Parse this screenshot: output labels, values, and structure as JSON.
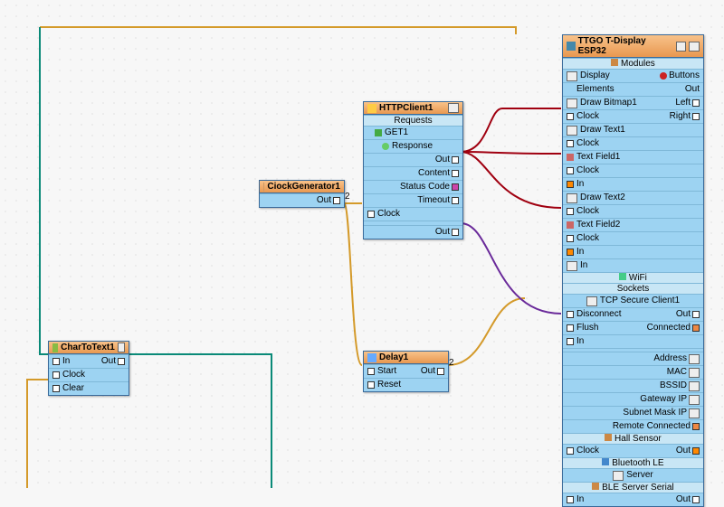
{
  "nodes": {
    "char": {
      "title": "CharToText1",
      "rows": [
        "In",
        "Clock",
        "Clear"
      ],
      "out": "Out"
    },
    "clockgen": {
      "title": "CiockGenerator1",
      "out": "Out"
    },
    "http": {
      "title": "HTTPClient1",
      "sec1": "Requests",
      "rows": [
        "GET1",
        "Response"
      ],
      "outs": [
        "Out",
        "Content",
        "Status Code",
        "Timeout"
      ],
      "clock": "Clock",
      "bottom": "Out"
    },
    "delay": {
      "title": "Delay1",
      "rows": [
        "Start",
        "Reset"
      ],
      "out": "Out"
    },
    "esp": {
      "title": "TTGO T-Display ESP32",
      "modules": "Modules",
      "display": "Display",
      "buttons": "Buttons",
      "elements": "Elements",
      "out": "Out",
      "drawbm": "Draw Bitmap1",
      "left": "Left",
      "right": "Right",
      "clock": "Clock",
      "drawt1": "Draw Text1",
      "tf1": "Text Field1",
      "in": "In",
      "drawt2": "Draw Text2",
      "tf2": "Text Field2",
      "wifi": "WiFi",
      "sockets": "Sockets",
      "tcp": "TCP Secure Client1",
      "disconnect": "Disconnect",
      "connected": "Connected",
      "flush": "Flush",
      "address": "Address",
      "mac": "MAC",
      "bssid": "BSSID",
      "gateway": "Gateway IP",
      "subnet": "Subnet Mask IP",
      "remote": "Remote Connected",
      "hall": "Hall Sensor",
      "ble": "Bluetooth LE",
      "server": "Server",
      "bleser": "BLE Server Serial"
    }
  }
}
